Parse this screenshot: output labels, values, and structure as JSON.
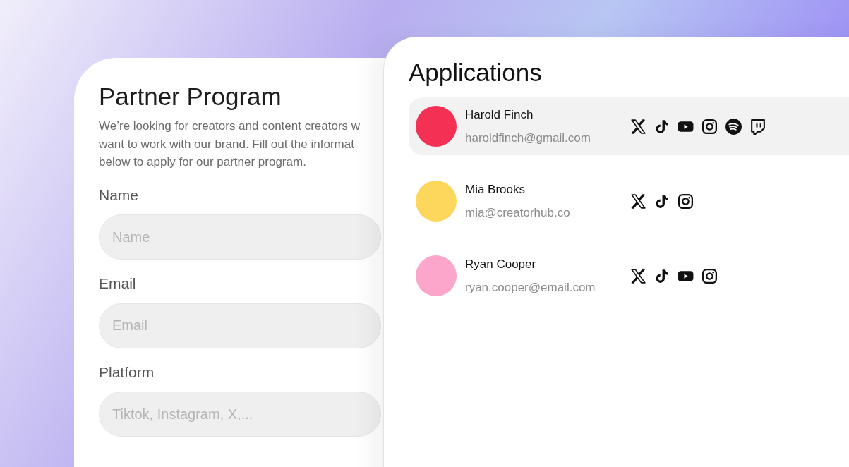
{
  "form": {
    "title": "Partner Program",
    "description_lines": [
      "We’re looking for creators and content creators w",
      "want to work with our brand. Fill out the informat",
      "below to apply for our partner program."
    ],
    "fields": [
      {
        "label": "Name",
        "placeholder": "Name"
      },
      {
        "label": "Email",
        "placeholder": "Email"
      },
      {
        "label": "Platform",
        "placeholder": "Tiktok, Instagram, X,..."
      }
    ]
  },
  "applications": {
    "title": "Applications",
    "rows": [
      {
        "name": "Harold Finch",
        "email": "haroldfinch@gmail.com",
        "color": "#f43154",
        "selected": true,
        "icons": [
          {
            "kind": "x"
          },
          {
            "kind": "tiktok"
          },
          {
            "kind": "youtube"
          },
          {
            "kind": "instagram"
          },
          {
            "kind": "spotify"
          },
          {
            "kind": "twitch"
          }
        ]
      },
      {
        "name": "Mia Brooks",
        "email": "mia@creatorhub.co",
        "color": "#fdd75c",
        "selected": false,
        "icons": [
          {
            "kind": "x"
          },
          {
            "kind": "tiktok"
          },
          {
            "kind": "instagram"
          }
        ]
      },
      {
        "name": "Ryan Cooper",
        "email": "ryan.cooper@email.com",
        "color": "#fca6cc",
        "selected": false,
        "icons": [
          {
            "kind": "x"
          },
          {
            "kind": "tiktok"
          },
          {
            "kind": "youtube"
          },
          {
            "kind": "instagram"
          }
        ]
      }
    ]
  }
}
